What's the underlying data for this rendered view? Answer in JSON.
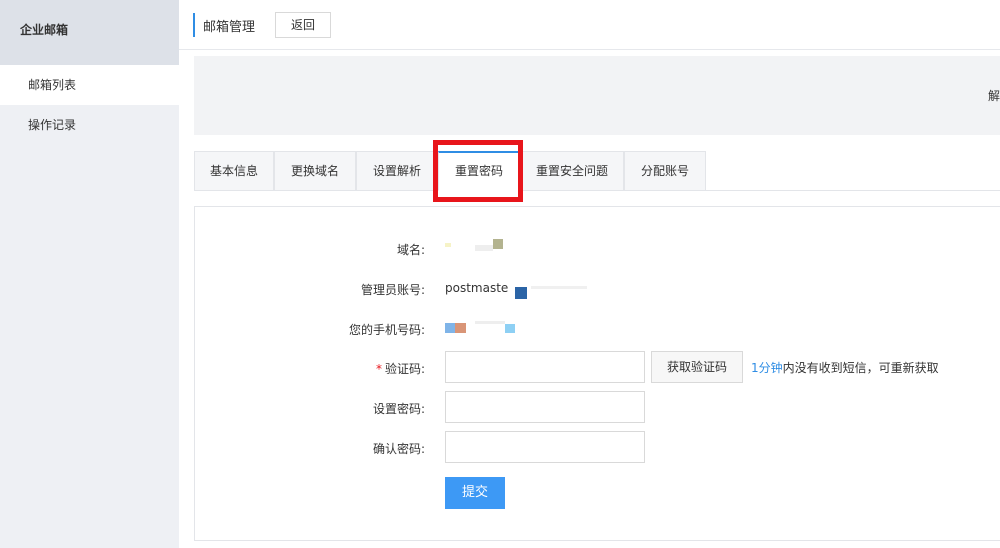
{
  "sidebar": {
    "title": "企业邮箱",
    "items": [
      {
        "label": "邮箱列表"
      },
      {
        "label": "操作记录"
      }
    ]
  },
  "header": {
    "title": "邮箱管理",
    "back_label": "返回"
  },
  "banner": {
    "peek_text": "解"
  },
  "tabs": [
    {
      "label": "基本信息"
    },
    {
      "label": "更换域名"
    },
    {
      "label": "设置解析"
    },
    {
      "label": "重置密码"
    },
    {
      "label": "重置安全问题"
    },
    {
      "label": "分配账号"
    }
  ],
  "active_tab": "重置密码",
  "form": {
    "domain_label": "域名:",
    "admin_label": "管理员账号:",
    "admin_value": "postmaste",
    "phone_label": "您的手机号码:",
    "code_label": "验证码:",
    "get_code_label": "获取验证码",
    "hint_highlight": "1分钟",
    "hint_rest": "内没有收到短信，可重新获取",
    "new_password_label": "设置密码:",
    "confirm_password_label": "确认密码:",
    "submit_label": "提交",
    "code_value": "",
    "new_password_value": "",
    "confirm_password_value": ""
  },
  "colors": {
    "accent": "#2f8de4",
    "submit": "#3d99f5",
    "highlight_box": "#e8151b",
    "required_mark": "#e8151b"
  }
}
